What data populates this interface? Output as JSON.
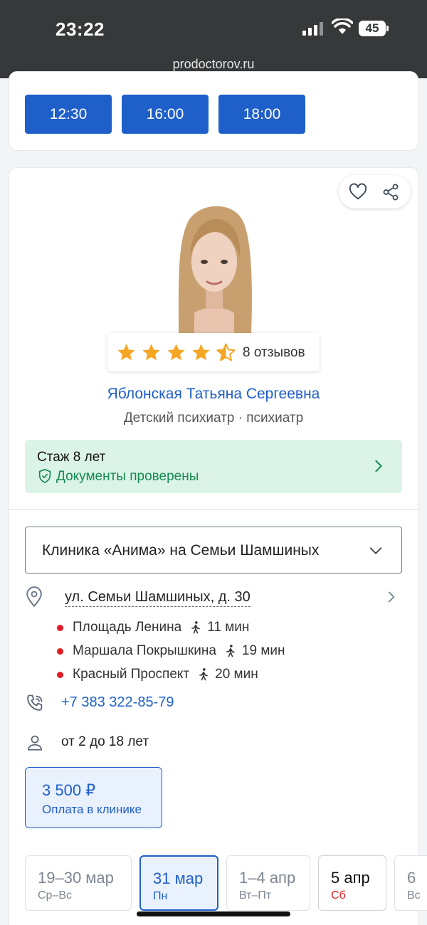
{
  "status_bar": {
    "time": "23:22",
    "battery": "45",
    "url": "prodoctorov.ru"
  },
  "time_slots": [
    "12:30",
    "16:00",
    "18:00"
  ],
  "doctor": {
    "rating_stars": 4.5,
    "reviews": "8 отзывов",
    "name": "Яблонская Татьяна Сергеевна",
    "specialty": "Детский психиатр · психиатр",
    "experience": "Стаж 8 лет",
    "documents": "Документы проверены"
  },
  "clinic": {
    "name": "Клиника «Анима» на Семьи Шамшиных",
    "address": "ул. Семьи Шамшиных, д. 30",
    "metro": [
      {
        "station": "Площадь Ленина",
        "walk": "11 мин"
      },
      {
        "station": "Маршала Покрышкина",
        "walk": "19 мин"
      },
      {
        "station": "Красный Проспект",
        "walk": "20 мин"
      }
    ],
    "phone": "+7 383 322-85-79",
    "age": "от 2 до 18 лет"
  },
  "price": {
    "amount": "3 500 ₽",
    "note": "Оплата в клинике"
  },
  "dates": [
    {
      "range": "19–30 мар",
      "days": "Ср–Вс"
    },
    {
      "range": "31 мар",
      "days": "Пн"
    },
    {
      "range": "1–4 апр",
      "days": "Вт–Пт"
    },
    {
      "range": "5 апр",
      "days": "Сб"
    },
    {
      "range": "6",
      "days": "Вс"
    }
  ],
  "colors": {
    "accent": "#1f5fc9",
    "success": "#158a50",
    "metro": "#e31b23",
    "star": "#f5a623"
  }
}
